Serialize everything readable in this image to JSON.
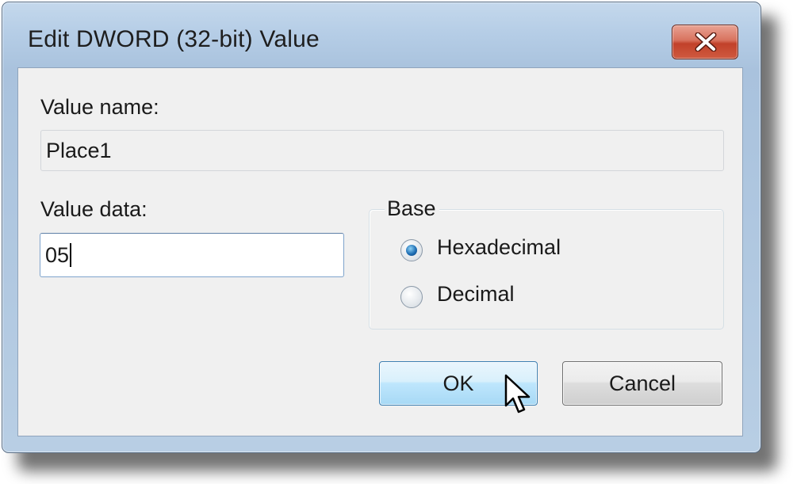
{
  "window": {
    "title": "Edit DWORD (32-bit) Value"
  },
  "value_name": {
    "label": "Value name:",
    "value": "Place1"
  },
  "value_data": {
    "label": "Value data:",
    "value": "05"
  },
  "base": {
    "legend": "Base",
    "options": [
      {
        "label": "Hexadecimal",
        "selected": true
      },
      {
        "label": "Decimal",
        "selected": false
      }
    ]
  },
  "buttons": {
    "ok_label": "OK",
    "cancel_label": "Cancel"
  },
  "icons": {
    "close": "close-icon",
    "pointer": "mouse-pointer-icon"
  },
  "colors": {
    "close_button": "#c2412a",
    "ok_button_border": "#3c7fb1",
    "radio_dot": "#1f6fb5"
  }
}
